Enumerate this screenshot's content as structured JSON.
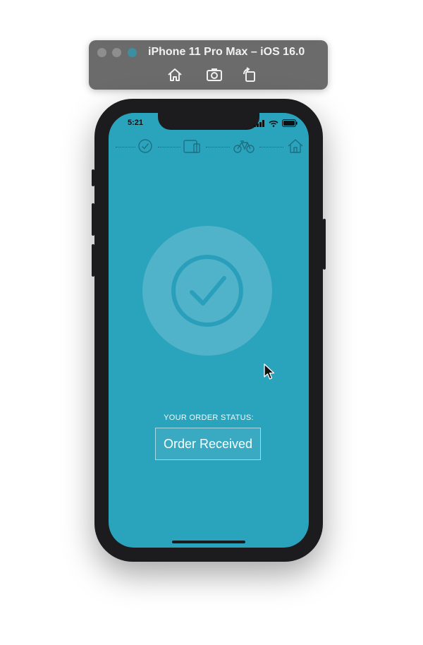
{
  "simulator": {
    "title": "iPhone 11 Pro Max – iOS 16.0",
    "buttons": {
      "home": "home-icon",
      "screenshot": "screenshot-icon",
      "rotate": "rotate-icon"
    }
  },
  "status_bar": {
    "time": "5:21"
  },
  "progress_steps": [
    "check-icon",
    "order-bag-icon",
    "bike-icon",
    "house-icon"
  ],
  "order": {
    "label": "YOUR ORDER STATUS:",
    "status": "Order Received"
  },
  "colors": {
    "screen_bg": "#2aa3bd",
    "icon_stroke": "#1f8fab",
    "sim_bar": "#6b6b6b"
  }
}
